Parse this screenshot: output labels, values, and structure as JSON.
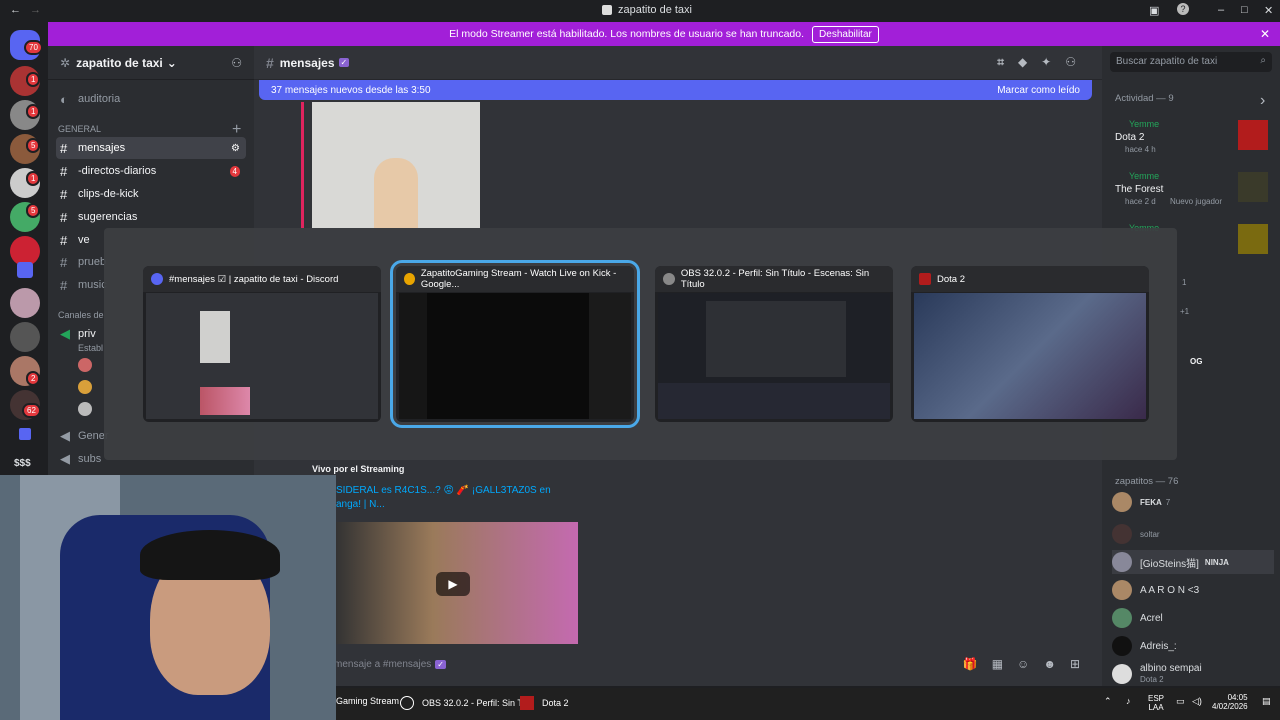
{
  "window": {
    "title": "zapatito de taxi"
  },
  "banner": {
    "text": "El modo Streamer está habilitado. Los nombres de usuario se han truncado.",
    "button": "Deshabilitar"
  },
  "server": {
    "name": "zapatito de taxi",
    "badge": "70"
  },
  "server_badges": [
    "1",
    "1",
    "5",
    "1",
    "5",
    "2",
    "62"
  ],
  "channels": {
    "category": "GENERAL",
    "auditoria": "auditoria",
    "items": [
      "mensajes",
      "-directos-diarios",
      "clips-de-kick",
      "sugerencias",
      "ve",
      "prueb",
      "music"
    ],
    "voice_category": "Canales de",
    "voice": "priv",
    "voice_sub": "Establ",
    "general": "Gener",
    "subs": "subs",
    "dollar": "$$$",
    "unread": "4"
  },
  "main": {
    "channel": "mensajes",
    "new_msgs": "37 mensajes nuevos desde las 3:50",
    "mark_read": "Marcar como leído",
    "stream_label": "Vivo por el Streaming",
    "link_text": "SIDERAL es R4C1S...? 😡 🧨 ¡GALL3TAZ0S en anga! | N...",
    "input_placeholder": "mensaje a #mensajes"
  },
  "search": {
    "placeholder": "Buscar zapatito de taxi"
  },
  "activity": {
    "header": "Actividad — 9",
    "items": [
      {
        "user": "Yemme",
        "game": "Dota 2",
        "meta": "hace 4 h"
      },
      {
        "user": "Yemme",
        "game": "The Forest",
        "meta": "hace 2 d",
        "extra": "Nuevo jugador"
      },
      {
        "user": "Yemme"
      }
    ],
    "counts": [
      "1",
      "+1"
    ],
    "og": "OG"
  },
  "members": {
    "header": "zapatitos — 76",
    "list": [
      {
        "name": "FEKA",
        "sub": "7"
      },
      {
        "name": "soltar"
      },
      {
        "name": "[GioSteins猫]",
        "tag": "NINJA"
      },
      {
        "name": "A A R O N <3"
      },
      {
        "name": "Acrel"
      },
      {
        "name": "Adreis_:"
      },
      {
        "name": "albino sempai",
        "sub": "Dota 2"
      }
    ]
  },
  "switcher": {
    "windows": [
      {
        "title": "#mensajes ☑ | zapatito de taxi - Discord",
        "color": "#5865f2"
      },
      {
        "title": "ZapatitoGaming Stream - Watch Live on Kick - Google...",
        "color": "#e8a400"
      },
      {
        "title": "OBS 32.0.2 - Perfil: Sin Título - Escenas: Sin Título",
        "color": "#888888"
      },
      {
        "title": "Dota 2",
        "color": "#b21c1c"
      }
    ],
    "selected_index": 1
  },
  "taskbar": {
    "items": [
      "Gaming Stream",
      "OBS 32.0.2 - Perfil: Sin T",
      "Dota 2"
    ],
    "lang": "ESP",
    "lang2": "LAA",
    "time": "04:05",
    "date": "4/02/2026"
  },
  "colors": {
    "accent": "#5865f2",
    "banner": "#a21fd8",
    "selection": "#4aa8e8"
  }
}
